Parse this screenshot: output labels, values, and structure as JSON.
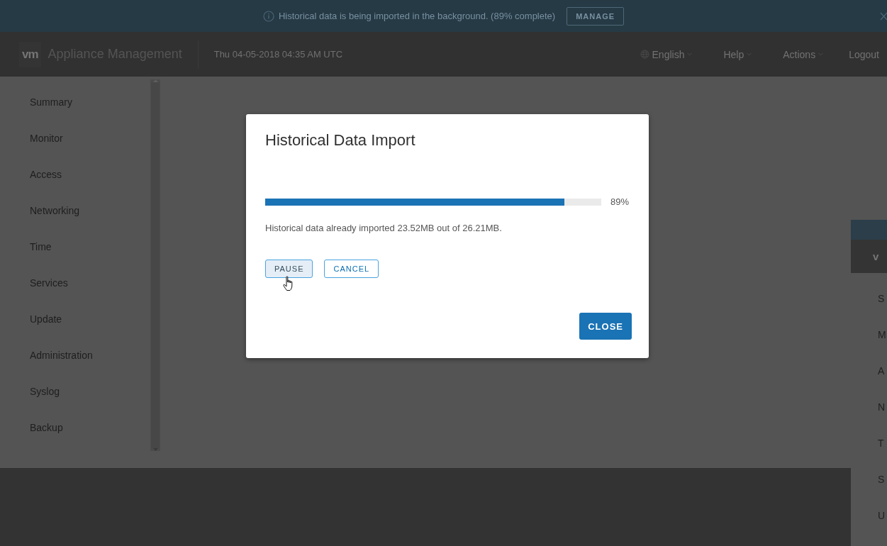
{
  "banner": {
    "message": "Historical data is being imported in the background. (89% complete)",
    "button": "MANAGE"
  },
  "header": {
    "logo": "vm",
    "title": "Appliance Management",
    "datetime": "Thu 04-05-2018 04:35 AM UTC",
    "menus": [
      {
        "label": "English",
        "kind": "language"
      },
      {
        "label": "Help",
        "kind": "dropdown"
      },
      {
        "label": "Actions",
        "kind": "dropdown"
      },
      {
        "label": "Logout",
        "kind": "link"
      }
    ]
  },
  "sidebar": {
    "items": [
      "Summary",
      "Monitor",
      "Access",
      "Networking",
      "Time",
      "Services",
      "Update",
      "Administration",
      "Syslog",
      "Backup"
    ]
  },
  "background_copy": {
    "logo": "v",
    "items": [
      "S",
      "M",
      "A",
      "N",
      "T",
      "S",
      "U"
    ]
  },
  "dialog": {
    "title": "Historical Data Import",
    "progress": {
      "level": 0.89,
      "reading": "89%"
    },
    "detail": "Historical data already imported 23.52MB out of 26.21MB.",
    "buttons": [
      {
        "label": "PAUSE",
        "hovered": true
      },
      {
        "label": "CANCEL",
        "hovered": false
      }
    ],
    "close": "CLOSE"
  }
}
